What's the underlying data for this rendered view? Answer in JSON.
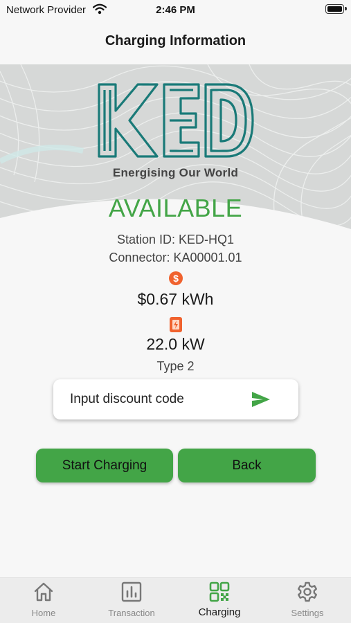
{
  "status_bar": {
    "carrier": "Network Provider",
    "time": "2:46 PM"
  },
  "header": {
    "title": "Charging Information"
  },
  "brand": {
    "logo_text": "KED",
    "tagline": "Energising Our World",
    "logo_color": "#1a7a78"
  },
  "station": {
    "status": "AVAILABLE",
    "station_id": "Station ID: KED-HQ1",
    "connector": "Connector: KA00001.01",
    "price": "$0.67 kWh",
    "power": "22.0 kW",
    "type": "Type 2",
    "status_color": "#43a547"
  },
  "discount": {
    "placeholder": "Input discount code",
    "send_icon": "send-icon"
  },
  "actions": {
    "start_label": "Start Charging",
    "back_label": "Back",
    "button_color": "#43a547"
  },
  "tabbar": {
    "active": "Charging",
    "items": [
      {
        "label": "Home",
        "icon": "home-icon"
      },
      {
        "label": "Transaction",
        "icon": "bar-chart-icon"
      },
      {
        "label": "Charging",
        "icon": "qr-code-icon"
      },
      {
        "label": "Settings",
        "icon": "gear-icon"
      }
    ]
  }
}
